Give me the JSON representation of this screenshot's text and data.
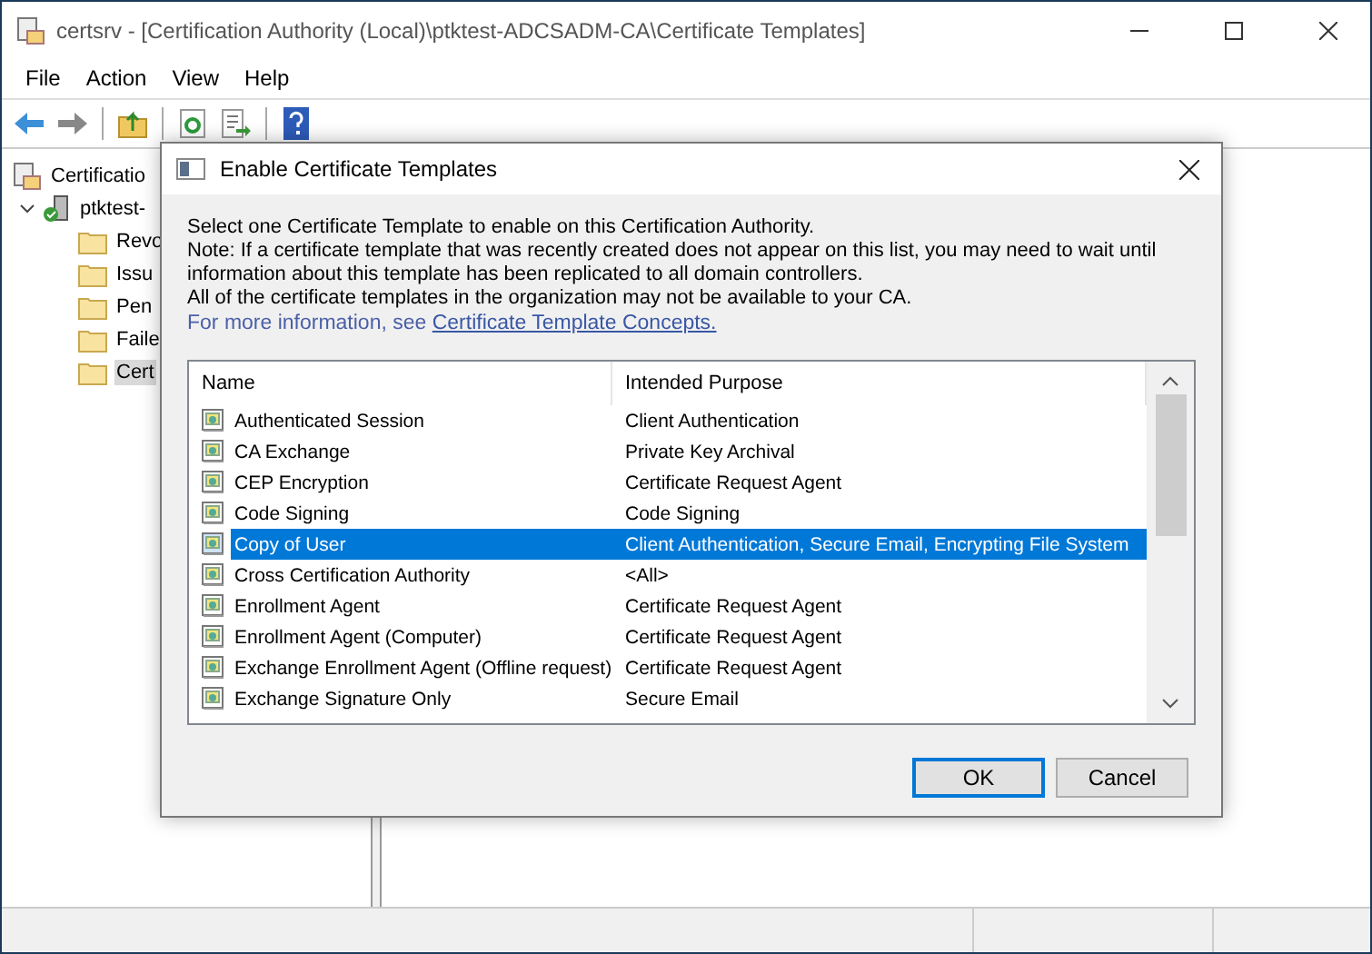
{
  "window": {
    "title": "certsrv - [Certification Authority (Local)\\ptktest-ADCSADM-CA\\Certificate Templates]"
  },
  "menu": [
    "File",
    "Action",
    "View",
    "Help"
  ],
  "tree": [
    {
      "label": "Certificatio",
      "selected": false,
      "children": [
        {
          "label": "ptktest-",
          "selected": false,
          "expanded": true,
          "children": [
            {
              "label": "Revo",
              "selected": false
            },
            {
              "label": "Issu",
              "selected": false
            },
            {
              "label": "Pen",
              "selected": false
            },
            {
              "label": "Faile",
              "selected": false
            },
            {
              "label": "Cert",
              "selected": true
            }
          ]
        }
      ]
    }
  ],
  "dialog": {
    "title": "Enable Certificate Templates",
    "description_lines": [
      "Select one Certificate Template to enable on this Certification Authority.",
      "Note: If a certificate template that was recently created does not appear on this list, you may need to wait until",
      "information about this template has been replicated to all domain controllers.",
      "All of the certificate templates in the organization may not be available to your CA."
    ],
    "info_prefix": "For more information, see ",
    "info_link": "Certificate Template Concepts.",
    "columns": [
      "Name",
      "Intended Purpose"
    ],
    "rows": [
      {
        "name": "Authenticated Session",
        "purpose": "Client Authentication",
        "selected": false
      },
      {
        "name": "CA Exchange",
        "purpose": "Private Key Archival",
        "selected": false
      },
      {
        "name": "CEP Encryption",
        "purpose": "Certificate Request Agent",
        "selected": false
      },
      {
        "name": "Code Signing",
        "purpose": "Code Signing",
        "selected": false
      },
      {
        "name": "Copy of User",
        "purpose": "Client Authentication, Secure Email, Encrypting File System",
        "selected": true
      },
      {
        "name": "Cross Certification Authority",
        "purpose": "<All>",
        "selected": false
      },
      {
        "name": "Enrollment Agent",
        "purpose": "Certificate Request Agent",
        "selected": false
      },
      {
        "name": "Enrollment Agent (Computer)",
        "purpose": "Certificate Request Agent",
        "selected": false
      },
      {
        "name": "Exchange Enrollment Agent (Offline request)",
        "purpose": "Certificate Request Agent",
        "selected": false
      },
      {
        "name": "Exchange Signature Only",
        "purpose": "Secure Email",
        "selected": false
      }
    ],
    "buttons": [
      {
        "label": "OK",
        "default": true
      },
      {
        "label": "Cancel",
        "default": false
      }
    ]
  }
}
